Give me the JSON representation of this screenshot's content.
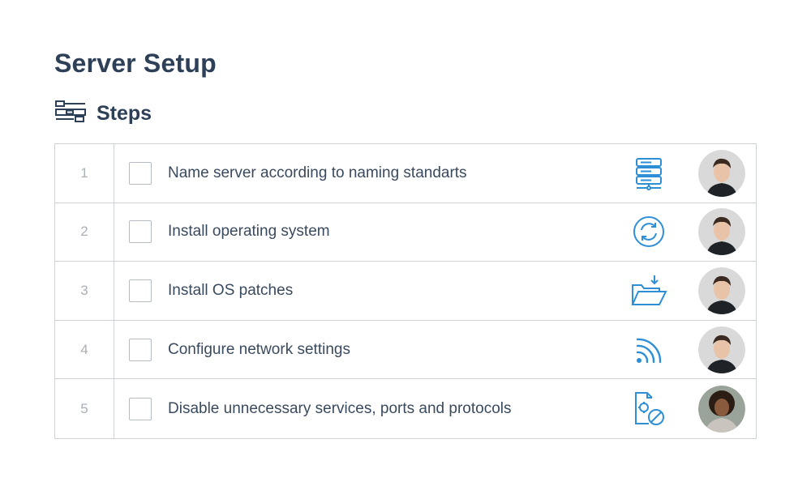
{
  "page": {
    "title": "Server Setup"
  },
  "section": {
    "title": "Steps",
    "icon": "workflow-steps-icon"
  },
  "accent_color": "#2f8fd6",
  "steps": [
    {
      "number": "1",
      "label": "Name server according to naming standarts",
      "icon": "server-icon",
      "checked": false
    },
    {
      "number": "2",
      "label": "Install operating system",
      "icon": "sync-icon",
      "checked": false
    },
    {
      "number": "3",
      "label": "Install OS patches",
      "icon": "folder-download-icon",
      "checked": false
    },
    {
      "number": "4",
      "label": "Configure network settings",
      "icon": "network-signal-icon",
      "checked": false
    },
    {
      "number": "5",
      "label": "Disable unnecessary services, ports and protocols",
      "icon": "disable-settings-icon",
      "checked": false
    }
  ]
}
